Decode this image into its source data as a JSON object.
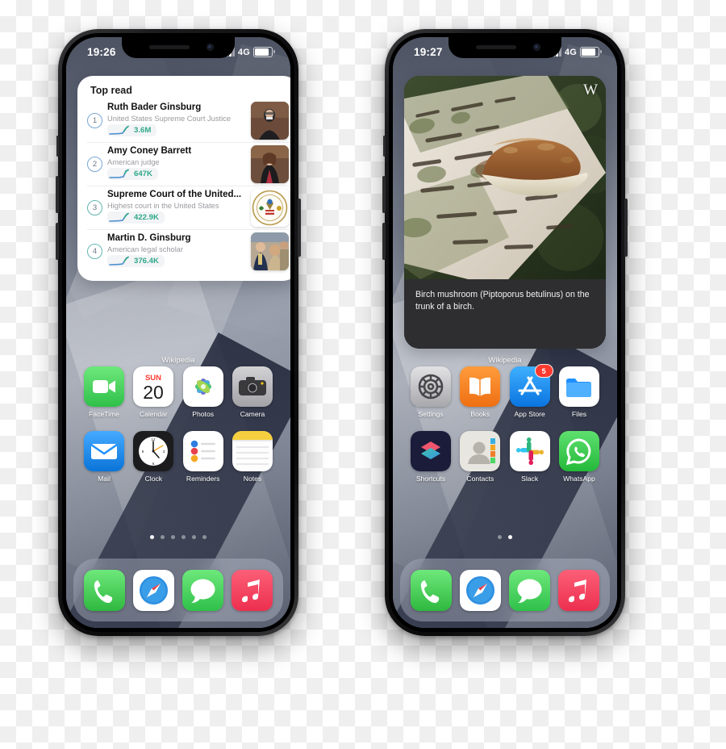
{
  "scene": {
    "description": "Two iPhone mockups side by side showing iOS home screens with Wikipedia widgets"
  },
  "phones": [
    {
      "id": "phone-left",
      "status_bar": {
        "time": "19:26",
        "network": "4G",
        "signal_bars": 3,
        "battery_icon": "battery-icon"
      },
      "widget": {
        "type": "top-read",
        "title": "Top read",
        "source_label": "Wikipedia",
        "items": [
          {
            "rank": "1",
            "name": "Ruth Bader Ginsburg",
            "description": "United States Supreme Court Justice",
            "views": "3.6M",
            "thumb": "portrait-rbg"
          },
          {
            "rank": "2",
            "name": "Amy Coney Barrett",
            "description": "American judge",
            "views": "647K",
            "thumb": "portrait-acb"
          },
          {
            "rank": "3",
            "name": "Supreme Court of the United...",
            "description": "Highest court in the United States",
            "views": "422.9K",
            "thumb": "scotus-seal"
          },
          {
            "rank": "4",
            "name": "Martin D. Ginsburg",
            "description": "American legal scholar",
            "views": "376.4K",
            "thumb": "photo-group"
          }
        ]
      },
      "apps": [
        [
          {
            "label": "FaceTime",
            "icon": "facetime-icon",
            "badge": null
          },
          {
            "label": "Calendar",
            "icon": "calendar-icon",
            "badge": null,
            "weekday": "SUN",
            "day": "20"
          },
          {
            "label": "Photos",
            "icon": "photos-icon",
            "badge": null
          },
          {
            "label": "Camera",
            "icon": "camera-icon",
            "badge": null
          }
        ],
        [
          {
            "label": "Mail",
            "icon": "mail-icon",
            "badge": null
          },
          {
            "label": "Clock",
            "icon": "clock-icon",
            "badge": null
          },
          {
            "label": "Reminders",
            "icon": "reminders-icon",
            "badge": null
          },
          {
            "label": "Notes",
            "icon": "notes-icon",
            "badge": null
          }
        ]
      ],
      "page_dots": {
        "count": 6,
        "active_index": 0
      },
      "dock": [
        {
          "label": "Phone",
          "icon": "phone-icon"
        },
        {
          "label": "Safari",
          "icon": "safari-icon"
        },
        {
          "label": "Messages",
          "icon": "messages-icon"
        },
        {
          "label": "Music",
          "icon": "music-icon"
        }
      ]
    },
    {
      "id": "phone-right",
      "status_bar": {
        "time": "19:27",
        "network": "4G",
        "signal_bars": 3,
        "battery_icon": "battery-icon"
      },
      "widget": {
        "type": "picture-of-the-day",
        "caption": "Birch mushroom (Piptoporus betulinus) on the trunk of a birch.",
        "source_label": "Wikipedia",
        "watermark": "W",
        "license_icons": [
          "cc-icon",
          "by-icon",
          "sa-icon"
        ]
      },
      "apps": [
        [
          {
            "label": "Settings",
            "icon": "settings-icon",
            "badge": null
          },
          {
            "label": "Books",
            "icon": "books-icon",
            "badge": null
          },
          {
            "label": "App Store",
            "icon": "appstore-icon",
            "badge": "5"
          },
          {
            "label": "Files",
            "icon": "files-icon",
            "badge": null
          }
        ],
        [
          {
            "label": "Shortcuts",
            "icon": "shortcuts-icon",
            "badge": null
          },
          {
            "label": "Contacts",
            "icon": "contacts-icon",
            "badge": null
          },
          {
            "label": "Slack",
            "icon": "slack-icon",
            "badge": null
          },
          {
            "label": "WhatsApp",
            "icon": "whatsapp-icon",
            "badge": null
          }
        ]
      ],
      "page_dots": {
        "count": 2,
        "active_index": 1
      },
      "dock": [
        {
          "label": "Phone",
          "icon": "phone-icon"
        },
        {
          "label": "Safari",
          "icon": "safari-icon"
        },
        {
          "label": "Messages",
          "icon": "messages-icon"
        },
        {
          "label": "Music",
          "icon": "music-icon"
        }
      ]
    }
  ],
  "colors": {
    "trend_green": "#2fa88b",
    "trend_blue": "#4a8fd0",
    "badge_red": "#ff3b30",
    "widget_bg": "#ffffff",
    "caption_bg": "#2e2e30"
  }
}
